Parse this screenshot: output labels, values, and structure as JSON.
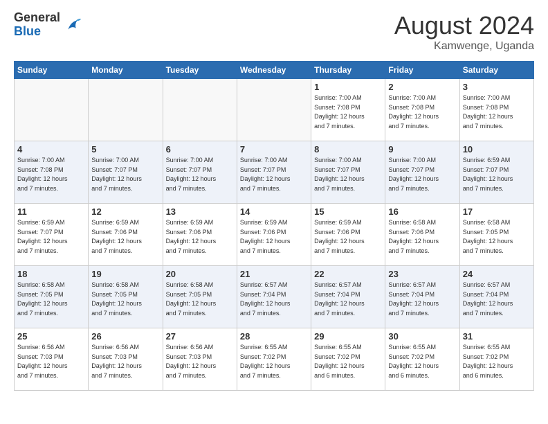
{
  "logo": {
    "general": "General",
    "blue": "Blue"
  },
  "title": "August 2024",
  "location": "Kamwenge, Uganda",
  "days_of_week": [
    "Sunday",
    "Monday",
    "Tuesday",
    "Wednesday",
    "Thursday",
    "Friday",
    "Saturday"
  ],
  "weeks": [
    [
      {
        "num": "",
        "info": ""
      },
      {
        "num": "",
        "info": ""
      },
      {
        "num": "",
        "info": ""
      },
      {
        "num": "",
        "info": ""
      },
      {
        "num": "1",
        "info": "Sunrise: 7:00 AM\nSunset: 7:08 PM\nDaylight: 12 hours\nand 7 minutes."
      },
      {
        "num": "2",
        "info": "Sunrise: 7:00 AM\nSunset: 7:08 PM\nDaylight: 12 hours\nand 7 minutes."
      },
      {
        "num": "3",
        "info": "Sunrise: 7:00 AM\nSunset: 7:08 PM\nDaylight: 12 hours\nand 7 minutes."
      }
    ],
    [
      {
        "num": "4",
        "info": "Sunrise: 7:00 AM\nSunset: 7:08 PM\nDaylight: 12 hours\nand 7 minutes."
      },
      {
        "num": "5",
        "info": "Sunrise: 7:00 AM\nSunset: 7:07 PM\nDaylight: 12 hours\nand 7 minutes."
      },
      {
        "num": "6",
        "info": "Sunrise: 7:00 AM\nSunset: 7:07 PM\nDaylight: 12 hours\nand 7 minutes."
      },
      {
        "num": "7",
        "info": "Sunrise: 7:00 AM\nSunset: 7:07 PM\nDaylight: 12 hours\nand 7 minutes."
      },
      {
        "num": "8",
        "info": "Sunrise: 7:00 AM\nSunset: 7:07 PM\nDaylight: 12 hours\nand 7 minutes."
      },
      {
        "num": "9",
        "info": "Sunrise: 7:00 AM\nSunset: 7:07 PM\nDaylight: 12 hours\nand 7 minutes."
      },
      {
        "num": "10",
        "info": "Sunrise: 6:59 AM\nSunset: 7:07 PM\nDaylight: 12 hours\nand 7 minutes."
      }
    ],
    [
      {
        "num": "11",
        "info": "Sunrise: 6:59 AM\nSunset: 7:07 PM\nDaylight: 12 hours\nand 7 minutes."
      },
      {
        "num": "12",
        "info": "Sunrise: 6:59 AM\nSunset: 7:06 PM\nDaylight: 12 hours\nand 7 minutes."
      },
      {
        "num": "13",
        "info": "Sunrise: 6:59 AM\nSunset: 7:06 PM\nDaylight: 12 hours\nand 7 minutes."
      },
      {
        "num": "14",
        "info": "Sunrise: 6:59 AM\nSunset: 7:06 PM\nDaylight: 12 hours\nand 7 minutes."
      },
      {
        "num": "15",
        "info": "Sunrise: 6:59 AM\nSunset: 7:06 PM\nDaylight: 12 hours\nand 7 minutes."
      },
      {
        "num": "16",
        "info": "Sunrise: 6:58 AM\nSunset: 7:06 PM\nDaylight: 12 hours\nand 7 minutes."
      },
      {
        "num": "17",
        "info": "Sunrise: 6:58 AM\nSunset: 7:05 PM\nDaylight: 12 hours\nand 7 minutes."
      }
    ],
    [
      {
        "num": "18",
        "info": "Sunrise: 6:58 AM\nSunset: 7:05 PM\nDaylight: 12 hours\nand 7 minutes."
      },
      {
        "num": "19",
        "info": "Sunrise: 6:58 AM\nSunset: 7:05 PM\nDaylight: 12 hours\nand 7 minutes."
      },
      {
        "num": "20",
        "info": "Sunrise: 6:58 AM\nSunset: 7:05 PM\nDaylight: 12 hours\nand 7 minutes."
      },
      {
        "num": "21",
        "info": "Sunrise: 6:57 AM\nSunset: 7:04 PM\nDaylight: 12 hours\nand 7 minutes."
      },
      {
        "num": "22",
        "info": "Sunrise: 6:57 AM\nSunset: 7:04 PM\nDaylight: 12 hours\nand 7 minutes."
      },
      {
        "num": "23",
        "info": "Sunrise: 6:57 AM\nSunset: 7:04 PM\nDaylight: 12 hours\nand 7 minutes."
      },
      {
        "num": "24",
        "info": "Sunrise: 6:57 AM\nSunset: 7:04 PM\nDaylight: 12 hours\nand 7 minutes."
      }
    ],
    [
      {
        "num": "25",
        "info": "Sunrise: 6:56 AM\nSunset: 7:03 PM\nDaylight: 12 hours\nand 7 minutes."
      },
      {
        "num": "26",
        "info": "Sunrise: 6:56 AM\nSunset: 7:03 PM\nDaylight: 12 hours\nand 7 minutes."
      },
      {
        "num": "27",
        "info": "Sunrise: 6:56 AM\nSunset: 7:03 PM\nDaylight: 12 hours\nand 7 minutes."
      },
      {
        "num": "28",
        "info": "Sunrise: 6:55 AM\nSunset: 7:02 PM\nDaylight: 12 hours\nand 7 minutes."
      },
      {
        "num": "29",
        "info": "Sunrise: 6:55 AM\nSunset: 7:02 PM\nDaylight: 12 hours\nand 6 minutes."
      },
      {
        "num": "30",
        "info": "Sunrise: 6:55 AM\nSunset: 7:02 PM\nDaylight: 12 hours\nand 6 minutes."
      },
      {
        "num": "31",
        "info": "Sunrise: 6:55 AM\nSunset: 7:02 PM\nDaylight: 12 hours\nand 6 minutes."
      }
    ]
  ]
}
